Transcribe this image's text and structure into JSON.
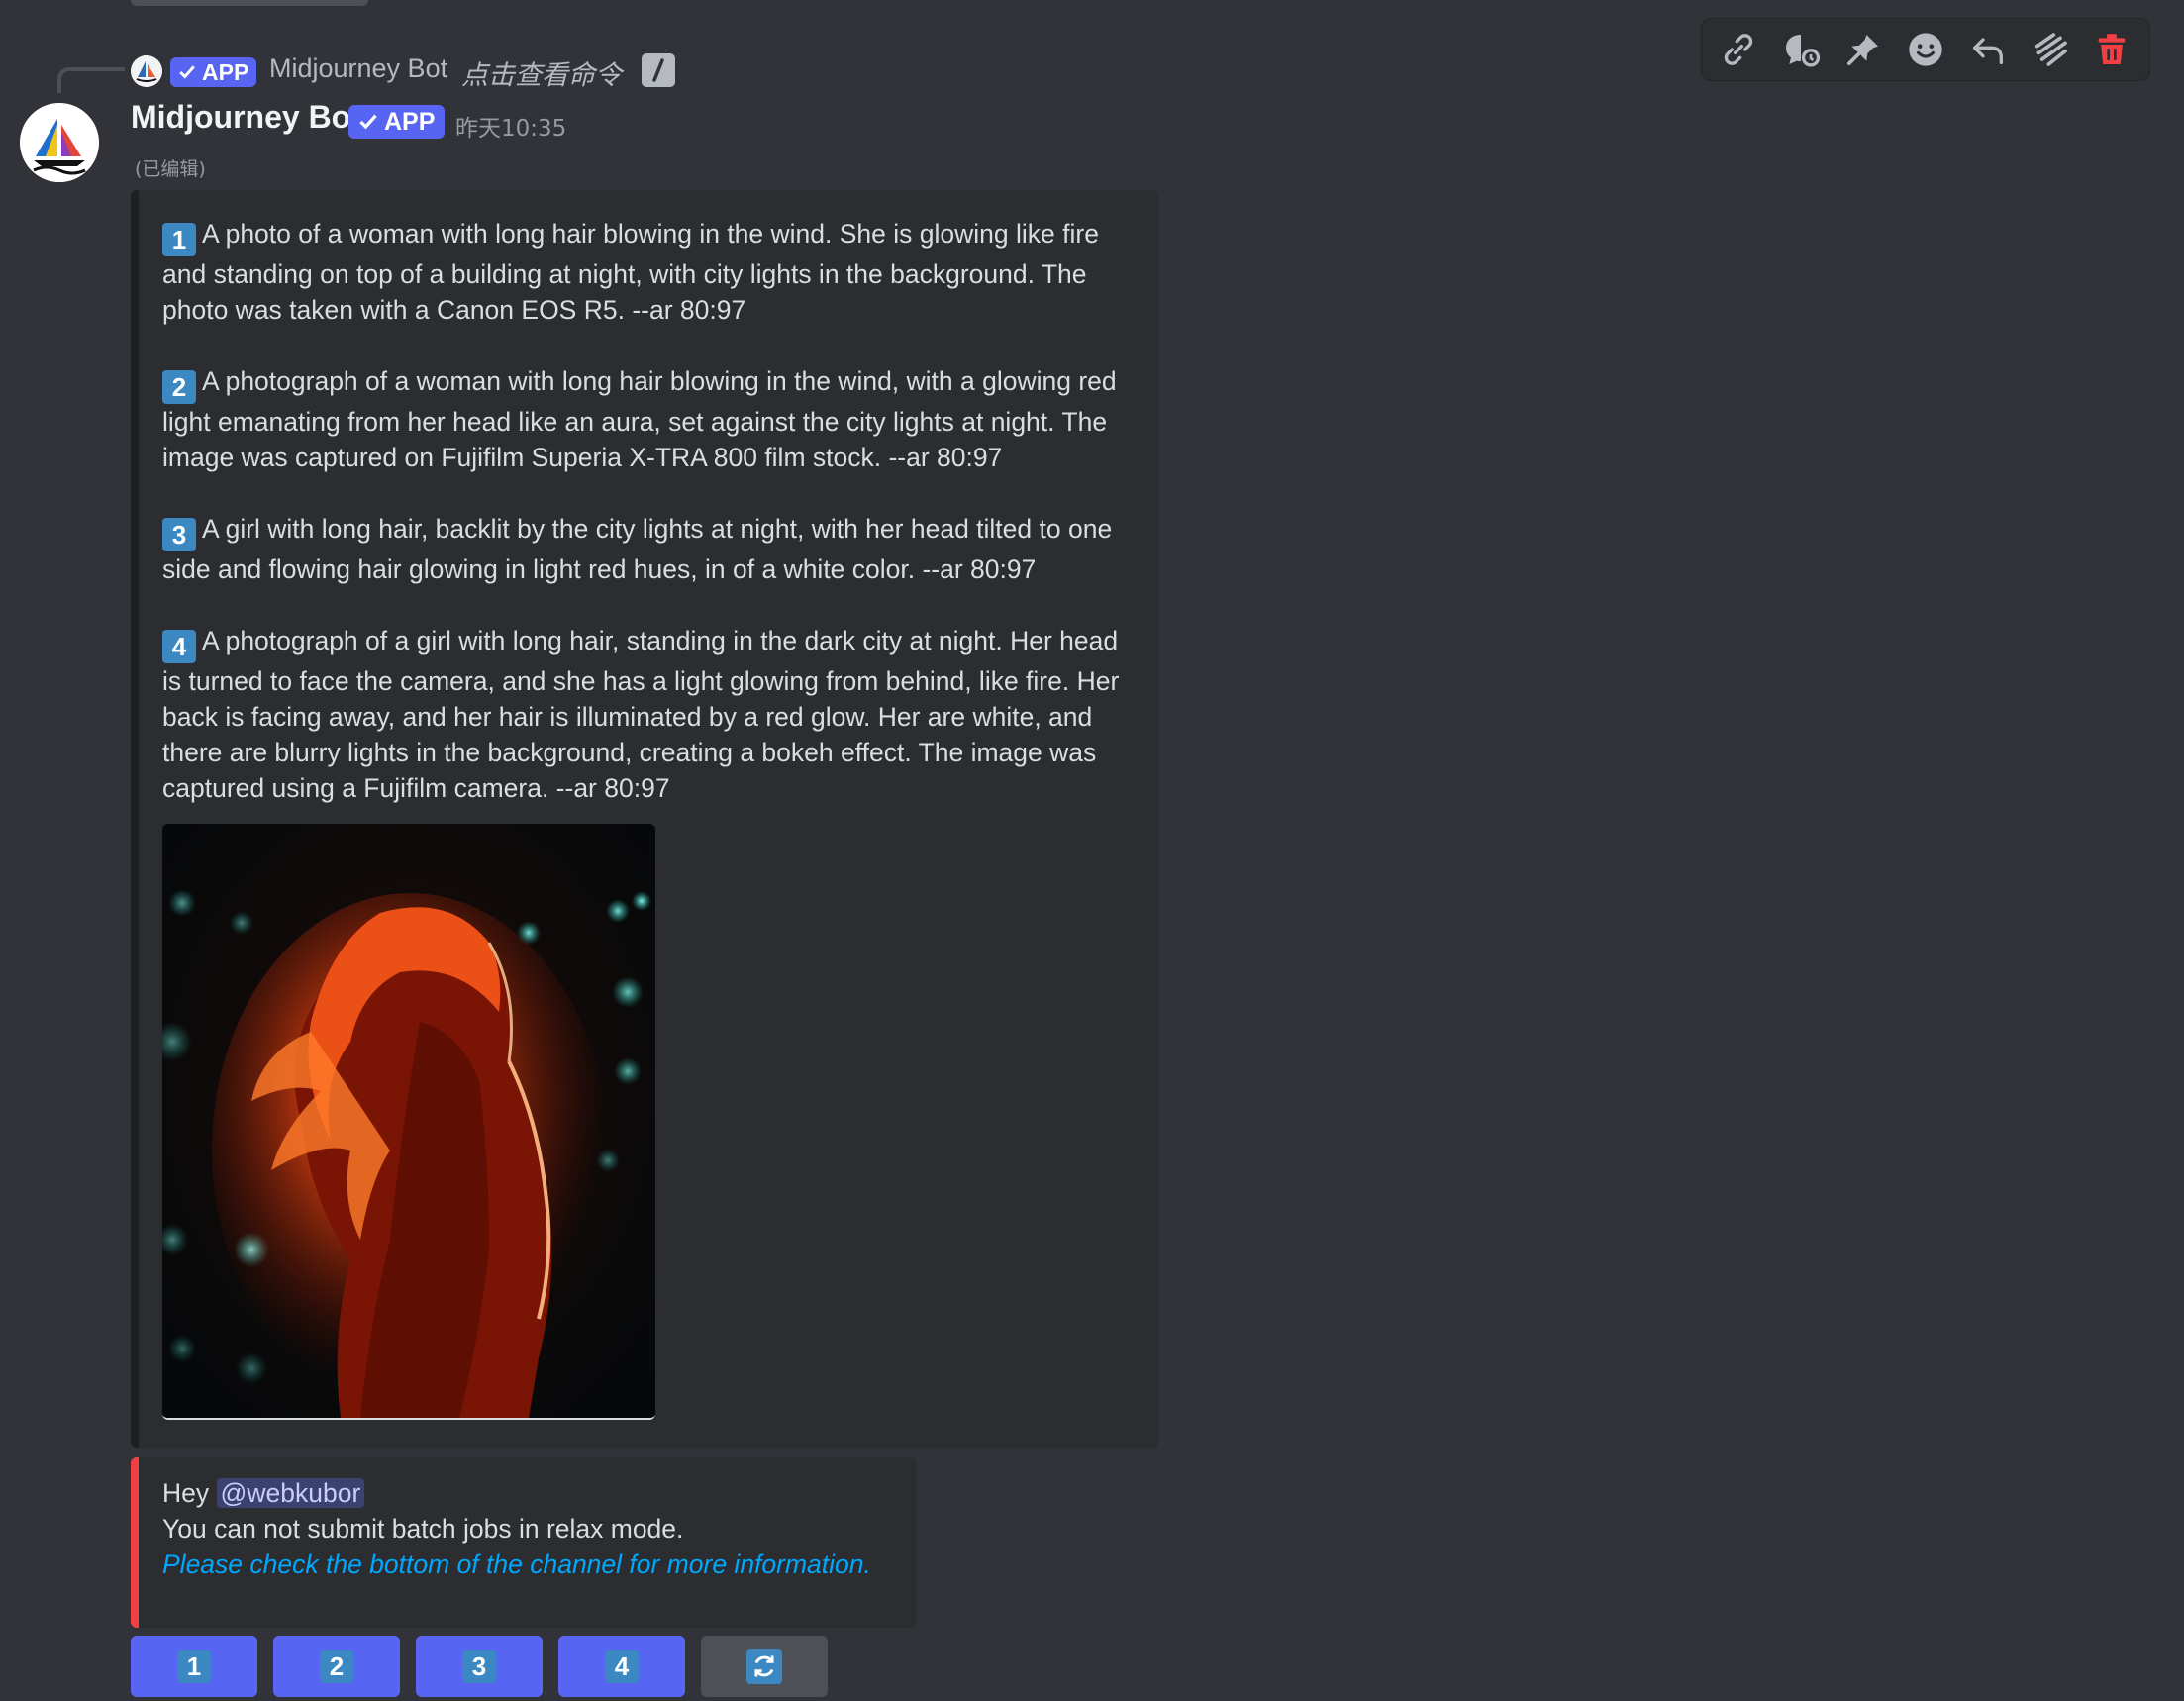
{
  "reply": {
    "badge": "APP",
    "author": "Midjourney Bot",
    "command_text": "点击查看命令"
  },
  "message": {
    "author": "Midjourney Bot",
    "badge": "APP",
    "timestamp": "昨天10:35",
    "edited": "(已编辑)"
  },
  "toolbar": {
    "icons": [
      "link-icon",
      "thread-icon",
      "pin-icon",
      "emoji-icon",
      "reply-icon",
      "more-icon",
      "delete-icon"
    ]
  },
  "embed": {
    "prompts": [
      {
        "number": "1",
        "text": "A photo of a woman with long hair blowing in the wind. She is glowing like fire and standing on top of a building at night, with city lights in the background. The photo was taken with a Canon EOS R5. --ar 80:97"
      },
      {
        "number": "2",
        "text": "A photograph of a woman with long hair blowing in the wind, with a glowing red light emanating from her head like an aura, set against the city lights at night. The image was captured on Fujifilm Superia X-TRA 800 film stock. --ar 80:97"
      },
      {
        "number": "3",
        "text": "A girl with long hair, backlit by the city lights at night, with her head tilted to one side and flowing hair glowing in light red hues, in of a white color. --ar 80:97"
      },
      {
        "number": "4",
        "text": "A photograph of a girl with long hair, standing in the dark city at night. Her head is turned to face the camera, and she has a light glowing from behind, like fire. Her back is facing away, and her hair is illuminated by a red glow. Her are white, and there are blurry lights in the background, creating a bokeh effect. The image was captured using a Fujifilm camera. --ar 80:97"
      }
    ]
  },
  "error_embed": {
    "greeting": "Hey",
    "mention": "@webkubor",
    "message": "You can not submit batch jobs in relax mode.",
    "link": "Please check the bottom of the channel for more information."
  },
  "buttons": [
    "1",
    "2",
    "3",
    "4"
  ],
  "colors": {
    "accent": "#5865f2",
    "error": "#f23f43",
    "link": "#00a8fc",
    "keycap": "#3b88c3"
  }
}
